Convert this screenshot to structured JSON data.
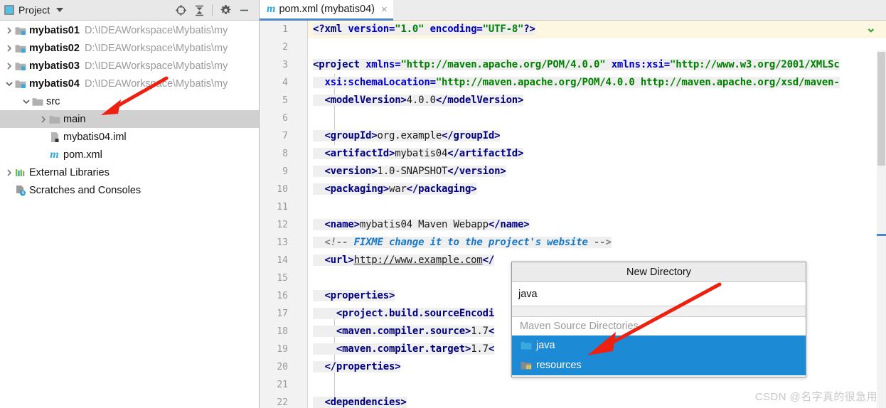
{
  "project_panel": {
    "title": "Project",
    "toolbar": [
      {
        "name": "locate-target-icon",
        "label": "Select Opened File"
      },
      {
        "name": "collapse-all-icon",
        "label": "Collapse All"
      },
      {
        "name": "gear-icon",
        "label": "Settings"
      },
      {
        "name": "minimize-icon",
        "label": "Hide"
      }
    ],
    "tree": [
      {
        "label": "mybatis01",
        "path": "D:\\IDEAWorkspace\\Mybatis\\my",
        "icon": "module-folder-icon",
        "arrow": "collapsed",
        "indent": 0,
        "bold": true,
        "selected": false
      },
      {
        "label": "mybatis02",
        "path": "D:\\IDEAWorkspace\\Mybatis\\my",
        "icon": "module-folder-icon",
        "arrow": "collapsed",
        "indent": 0,
        "bold": true,
        "selected": false
      },
      {
        "label": "mybatis03",
        "path": "D:\\IDEAWorkspace\\Mybatis\\my",
        "icon": "module-folder-icon",
        "arrow": "collapsed",
        "indent": 0,
        "bold": true,
        "selected": false
      },
      {
        "label": "mybatis04",
        "path": "D:\\IDEAWorkspace\\Mybatis\\my",
        "icon": "module-folder-icon",
        "arrow": "expanded",
        "indent": 0,
        "bold": true,
        "selected": false
      },
      {
        "label": "src",
        "path": "",
        "icon": "folder-icon",
        "arrow": "expanded",
        "indent": 1,
        "bold": false,
        "selected": false
      },
      {
        "label": "main",
        "path": "",
        "icon": "folder-icon",
        "arrow": "collapsed",
        "indent": 2,
        "bold": false,
        "selected": true
      },
      {
        "label": "mybatis04.iml",
        "path": "",
        "icon": "iml-file-icon",
        "arrow": "none",
        "indent": 2,
        "bold": false,
        "selected": false
      },
      {
        "label": "pom.xml",
        "path": "",
        "icon": "maven-file-icon",
        "arrow": "none",
        "indent": 2,
        "bold": false,
        "selected": false
      },
      {
        "label": "External Libraries",
        "path": "",
        "icon": "libraries-icon",
        "arrow": "collapsed",
        "indent": 0,
        "bold": false,
        "selected": false
      },
      {
        "label": "Scratches and Consoles",
        "path": "",
        "icon": "scratches-icon",
        "arrow": "none",
        "indent": 0,
        "bold": false,
        "selected": false
      }
    ]
  },
  "editor": {
    "tab": {
      "label": "pom.xml (mybatis04)",
      "icon": "maven-file-icon",
      "close": "×"
    },
    "gutter_top_marker": "chevron-down-icon",
    "lines": [
      {
        "no": "1",
        "fold": "none",
        "highlighted": true,
        "tokens": [
          {
            "t": "<?",
            "c": "tok-punct"
          },
          {
            "t": "xml",
            "c": "tok-tag"
          },
          {
            "t": " version=",
            "c": "tok-attr"
          },
          {
            "t": "\"1.0\"",
            "c": "tok-val"
          },
          {
            "t": " encoding=",
            "c": "tok-attr"
          },
          {
            "t": "\"UTF-8\"",
            "c": "tok-val"
          },
          {
            "t": "?>",
            "c": "tok-punct"
          }
        ]
      },
      {
        "no": "2",
        "fold": "none",
        "highlighted": false,
        "tokens": []
      },
      {
        "no": "3",
        "fold": "open",
        "highlighted": false,
        "tokens": [
          {
            "t": "<project",
            "c": "tok-tag"
          },
          {
            "t": " xmlns=",
            "c": "tok-attr"
          },
          {
            "t": "\"http://maven.apache.org/POM/4.0.0\"",
            "c": "tok-val"
          },
          {
            "t": " xmlns",
            "c": "tok-attr"
          },
          {
            "t": ":",
            "c": "tok-punct"
          },
          {
            "t": "xsi=",
            "c": "tok-attr"
          },
          {
            "t": "\"http://www.w3.org/2001/XMLSc",
            "c": "tok-val"
          }
        ]
      },
      {
        "no": "4",
        "fold": "none",
        "highlighted": false,
        "tokens": [
          {
            "t": "  xsi",
            "c": "tok-attr"
          },
          {
            "t": ":",
            "c": "tok-punct"
          },
          {
            "t": "schemaLocation=",
            "c": "tok-attr"
          },
          {
            "t": "\"http://maven.apache.org/POM/4.0.0 http://maven.apache.org/xsd/maven-",
            "c": "tok-val"
          }
        ]
      },
      {
        "no": "5",
        "fold": "none",
        "highlighted": false,
        "tokens": [
          {
            "t": "  <modelVersion>",
            "c": "tok-tag"
          },
          {
            "t": "4.0.0",
            "c": "tok-text"
          },
          {
            "t": "</modelVersion>",
            "c": "tok-tag"
          }
        ]
      },
      {
        "no": "6",
        "fold": "none",
        "highlighted": false,
        "tokens": []
      },
      {
        "no": "7",
        "fold": "none",
        "highlighted": false,
        "tokens": [
          {
            "t": "  <groupId>",
            "c": "tok-tag"
          },
          {
            "t": "org.example",
            "c": "tok-text"
          },
          {
            "t": "</groupId>",
            "c": "tok-tag"
          }
        ]
      },
      {
        "no": "8",
        "fold": "none",
        "highlighted": false,
        "tokens": [
          {
            "t": "  <artifactId>",
            "c": "tok-tag"
          },
          {
            "t": "mybatis04",
            "c": "tok-text"
          },
          {
            "t": "</artifactId>",
            "c": "tok-tag"
          }
        ]
      },
      {
        "no": "9",
        "fold": "none",
        "highlighted": false,
        "tokens": [
          {
            "t": "  <version>",
            "c": "tok-tag"
          },
          {
            "t": "1.0-SNAPSHOT",
            "c": "tok-text"
          },
          {
            "t": "</version>",
            "c": "tok-tag"
          }
        ]
      },
      {
        "no": "10",
        "fold": "none",
        "highlighted": false,
        "tokens": [
          {
            "t": "  <packaging>",
            "c": "tok-tag"
          },
          {
            "t": "war",
            "c": "tok-text"
          },
          {
            "t": "</packaging>",
            "c": "tok-tag"
          }
        ]
      },
      {
        "no": "11",
        "fold": "none",
        "highlighted": false,
        "tokens": []
      },
      {
        "no": "12",
        "fold": "none",
        "highlighted": false,
        "tokens": [
          {
            "t": "  <name>",
            "c": "tok-tag"
          },
          {
            "t": "mybatis04 Maven Webapp",
            "c": "tok-text"
          },
          {
            "t": "</name>",
            "c": "tok-tag"
          }
        ]
      },
      {
        "no": "13",
        "fold": "none",
        "highlighted": false,
        "tokens": [
          {
            "t": "  <!-- ",
            "c": "tok-cmt"
          },
          {
            "t": "FIXME change it to the project's website",
            "c": "tok-cmt-hi"
          },
          {
            "t": " -->",
            "c": "tok-cmt"
          }
        ]
      },
      {
        "no": "14",
        "fold": "none",
        "highlighted": false,
        "tokens": [
          {
            "t": "  <url>",
            "c": "tok-tag"
          },
          {
            "t": "http://www.example.com",
            "c": "tok-url"
          },
          {
            "t": "</",
            "c": "tok-tag"
          }
        ]
      },
      {
        "no": "15",
        "fold": "none",
        "highlighted": false,
        "tokens": []
      },
      {
        "no": "16",
        "fold": "open",
        "highlighted": false,
        "tokens": [
          {
            "t": "  <properties>",
            "c": "tok-tag"
          }
        ]
      },
      {
        "no": "17",
        "fold": "none",
        "highlighted": false,
        "tokens": [
          {
            "t": "    <project.build.sourceEncodi",
            "c": "tok-tag"
          }
        ]
      },
      {
        "no": "18",
        "fold": "none",
        "highlighted": false,
        "tokens": [
          {
            "t": "    <maven.compiler.source>",
            "c": "tok-tag"
          },
          {
            "t": "1.7",
            "c": "tok-text"
          },
          {
            "t": "<",
            "c": "tok-tag"
          }
        ]
      },
      {
        "no": "19",
        "fold": "none",
        "highlighted": false,
        "tokens": [
          {
            "t": "    <maven.compiler.target>",
            "c": "tok-tag"
          },
          {
            "t": "1.7",
            "c": "tok-text"
          },
          {
            "t": "<",
            "c": "tok-tag"
          }
        ]
      },
      {
        "no": "20",
        "fold": "close",
        "highlighted": false,
        "tokens": [
          {
            "t": "  </properties>",
            "c": "tok-tag"
          }
        ]
      },
      {
        "no": "21",
        "fold": "none",
        "highlighted": false,
        "tokens": []
      },
      {
        "no": "22",
        "fold": "open",
        "highlighted": false,
        "tokens": [
          {
            "t": "  <dependencies>",
            "c": "tok-tag"
          }
        ]
      }
    ]
  },
  "new_directory_dialog": {
    "title": "New Directory",
    "input_value": "java",
    "group_label": "Maven Source Directories",
    "items": [
      {
        "label": "java",
        "icon": "source-folder-icon",
        "selected": true
      },
      {
        "label": "resources",
        "icon": "resource-folder-icon",
        "selected": true
      }
    ]
  },
  "watermark": "CSDN @名字真的很急用",
  "colors": {
    "selection_blue": "#1c8ad4",
    "tab_underline": "#4a86c8",
    "arrow_red": "#ee2010",
    "tree_selected": "#d0d0d0",
    "panel_header": "#e8e8e8"
  }
}
